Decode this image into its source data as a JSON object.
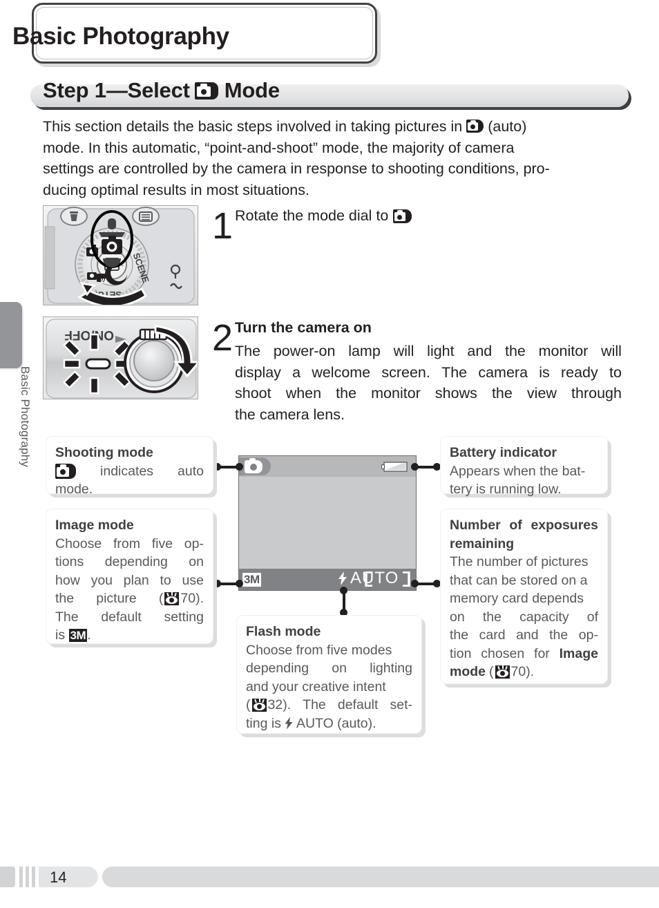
{
  "chapter": {
    "title": "Basic Photography",
    "side_tab_label": "Basic Photography"
  },
  "section": {
    "heading_pre": "Step 1—Select",
    "heading_post": "Mode",
    "icon": "camera-auto-icon"
  },
  "intro": {
    "line1_a": "This",
    "line1_b": "section",
    "line1_c": "details",
    "line1_d": "the",
    "line1_e": "basic",
    "line1_f": "steps",
    "line1_g": "involved",
    "line1_h": "in",
    "line1_i": "taking",
    "line1_j": "pictures",
    "line1_k": "in",
    "line1_l": "(auto)",
    "line2_a": "mode.",
    "line2_b": "In",
    "line2_c": "this",
    "line2_d": "automatic,",
    "line2_e": "“point-and-shoot”",
    "line2_f": "mode,",
    "line2_g": "the",
    "line2_h": "majority",
    "line2_i": "of",
    "line2_j": "camera",
    "line3": "settings are controlled by the camera in response to shooting conditions, pro-",
    "line4": "ducing optimal results in most situations."
  },
  "steps": [
    {
      "number": "1",
      "heading": "Rotate the mode dial to",
      "heading_icon": "camera-auto-icon",
      "figure": "mode-dial-illustration",
      "body": []
    },
    {
      "number": "2",
      "heading": "Turn the camera on",
      "figure": "power-switch-illustration",
      "body_l1_a": "The",
      "body_l1_b": "power-on",
      "body_l1_c": "lamp",
      "body_l1_d": "will",
      "body_l1_e": "light",
      "body_l1_f": "and",
      "body_l1_g": "the",
      "body_l1_h": "monitor",
      "body_l1_i": "will",
      "body_l2_a": "display",
      "body_l2_b": "a",
      "body_l2_c": "welcome",
      "body_l2_d": "screen.",
      "body_l2_e": "The",
      "body_l2_f": "camera",
      "body_l2_g": "is",
      "body_l2_h": "ready",
      "body_l2_i": "to",
      "body_l3_a": "shoot",
      "body_l3_b": "when",
      "body_l3_c": "the",
      "body_l3_d": "monitor",
      "body_l3_e": "shows",
      "body_l3_f": "the",
      "body_l3_g": "view",
      "body_l3_h": "through",
      "body_l4": "the camera lens."
    }
  ],
  "dial": {
    "labels": [
      "SCENE",
      "SETUP"
    ],
    "icons": [
      "trash-icon",
      "menu-icon",
      "movie-icon",
      "macro-icon",
      "playback-icon",
      "portrait-icon",
      "night-icon",
      "camera-auto-icon"
    ]
  },
  "power_switch": {
    "label": "ON/OFF"
  },
  "lcd": {
    "shooting_mode_icon": "camera-auto-icon",
    "battery_icon": "battery-indicator-icon",
    "image_mode_badge": "3M",
    "flash_label": "AUTO",
    "flash_icon": "flash-bolt-icon",
    "focus_brackets": "focus-area-brackets"
  },
  "callouts": {
    "shooting_mode": {
      "title": "Shooting mode",
      "l1_a": "indicates",
      "l1_b": "auto",
      "l2": "mode.",
      "icon": "camera-auto-icon"
    },
    "image_mode": {
      "title": "Image mode",
      "l1_a": "Choose",
      "l1_b": "from",
      "l1_c": "five",
      "l1_d": "op-",
      "l2_a": "tions",
      "l2_b": "depending",
      "l2_c": "on",
      "l3_a": "how",
      "l3_b": "you",
      "l3_c": "plan",
      "l3_d": "to",
      "l3_e": "use",
      "l4_a": "the",
      "l4_b": "picture",
      "l4_c": "(",
      "l4_page": "70).",
      "l5_a": "The",
      "l5_b": "default",
      "l5_c": "setting",
      "l6_a": "is",
      "l6_badge": "3M",
      "l6_b": ".",
      "ref_icon": "reference-eye-icon"
    },
    "battery_indicator": {
      "title": "Battery indicator",
      "l1": "Appears when the bat-",
      "l2": "tery is running low."
    },
    "exposures_remaining": {
      "title_l1_a": "Number",
      "title_l1_b": "of",
      "title_l1_c": "exposures",
      "title_l2": "remaining",
      "l1": "The number of pictures",
      "l2": "that can be stored on a",
      "l3": "memory card depends",
      "l4_a": "on",
      "l4_b": "the",
      "l4_c": "capacity",
      "l4_d": "of",
      "l5_a": "the",
      "l5_b": "card",
      "l5_c": "and",
      "l5_d": "the",
      "l5_e": "op-",
      "l6_a": "tion",
      "l6_b": "chosen",
      "l6_c": "for",
      "l6_bold": "Image",
      "l7_bold": "mode",
      "l7_open": "(",
      "l7_page": "70).",
      "ref_icon": "reference-eye-icon"
    },
    "flash_mode": {
      "title": "Flash mode",
      "l1": "Choose from five modes",
      "l2_a": "depending",
      "l2_b": "on",
      "l2_c": "lighting",
      "l3": "and your creative intent",
      "l4_open": "(",
      "l4_page": "32).",
      "l4_rest_a": "The",
      "l4_rest_b": "default",
      "l4_rest_c": "set-",
      "l5_a": "ting is",
      "l5_b": "AUTO (auto).",
      "ref_icon": "reference-eye-icon",
      "flash_icon": "flash-bolt-icon"
    }
  },
  "footer": {
    "page_number": "14"
  },
  "colors": {
    "ink": "#231f20",
    "gray_text": "#58595b",
    "tab_gray": "#939598",
    "bar_gray": "#d9dadb",
    "lcd_screen": "#c9cacc",
    "lcd_top": "#b6b8ba",
    "lcd_bottom": "#808285"
  }
}
